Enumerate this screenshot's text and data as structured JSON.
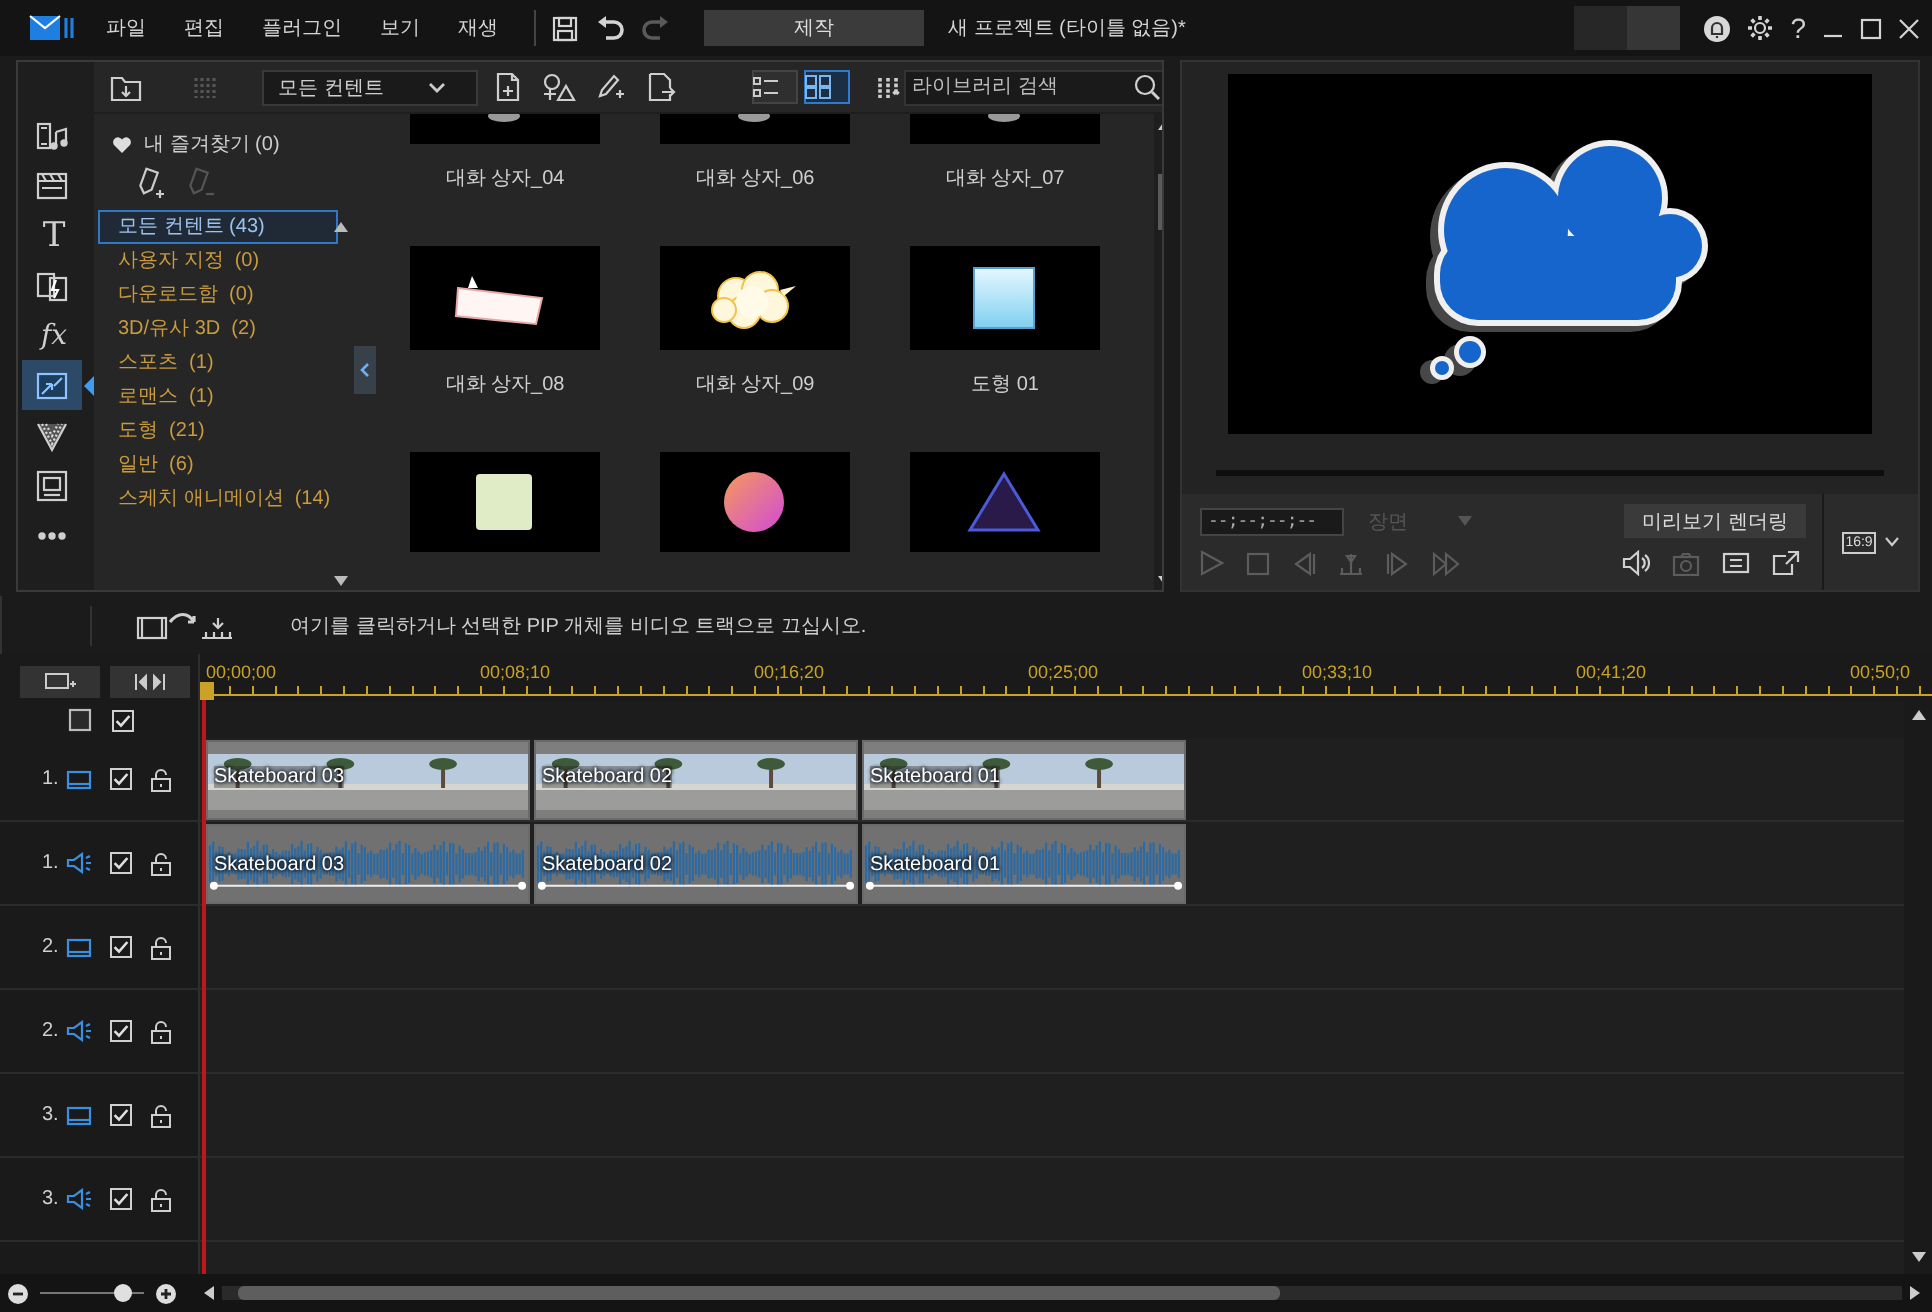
{
  "menu_bar": {
    "menus": [
      "파일",
      "편집",
      "플러그인",
      "보기",
      "재생"
    ],
    "undo_enabled": true,
    "redo_enabled": false,
    "produce": "제작",
    "title": "새 프로젝트 (타이틀 없음)*",
    "help": "?"
  },
  "library": {
    "rail": [
      {
        "kind": "media",
        "selected": false
      },
      {
        "kind": "title",
        "selected": false
      },
      {
        "kind": "text",
        "glyph": "T",
        "selected": false
      },
      {
        "kind": "transition",
        "selected": false
      },
      {
        "kind": "effect",
        "glyph": "fx",
        "selected": false
      },
      {
        "kind": "pip",
        "selected": true
      },
      {
        "kind": "particle",
        "selected": false
      },
      {
        "kind": "subtitle",
        "selected": false
      },
      {
        "kind": "more",
        "selected": false
      }
    ],
    "filter": "모든 컨텐트",
    "view_modes": [
      {
        "kind": "list",
        "selected": false
      },
      {
        "kind": "grid",
        "selected": true
      }
    ],
    "search": {
      "placeholder": "라이브러리 검색"
    },
    "favorites": "내 즐겨찾기 (0)",
    "categories": [
      {
        "label": "모든 컨텐트 (43)",
        "selected": true
      },
      {
        "label": "사용자 지정  (0)",
        "selected": false
      },
      {
        "label": "다운로드함  (0)",
        "selected": false
      },
      {
        "label": "3D/유사 3D  (2)",
        "selected": false
      },
      {
        "label": "스포츠  (1)",
        "selected": false
      },
      {
        "label": "로맨스  (1)",
        "selected": false
      },
      {
        "label": "도형  (21)",
        "selected": false
      },
      {
        "label": "일반  (6)",
        "selected": false
      },
      {
        "label": "스케치 애니메이션  (14)",
        "selected": false
      }
    ],
    "items": [
      {
        "label": "대화 상자_04",
        "kind": "cropped"
      },
      {
        "label": "대화 상자_06",
        "kind": "cropped"
      },
      {
        "label": "대화 상자_07",
        "kind": "cropped"
      },
      {
        "label": "대화 상자_08",
        "kind": "speech-bubble"
      },
      {
        "label": "대화 상자_09",
        "kind": "cloud"
      },
      {
        "label": "도형 01",
        "kind": "blue-square"
      },
      {
        "kind": "green-square"
      },
      {
        "kind": "circle"
      },
      {
        "kind": "triangle"
      }
    ]
  },
  "preview": {
    "timecode": "--;--;--;--",
    "scope": {
      "label": "장면",
      "disabled": true
    },
    "render_button": "미리보기 렌더링",
    "aspect": "16:9"
  },
  "timeline": {
    "hint": "여기를 클릭하거나 선택한 PIP 개체를 비디오 트랙으로 끄십시오.",
    "ruler": [
      "00;00;00",
      "00;08;10",
      "00;16;20",
      "00;25;00",
      "00;33;10",
      "00;41;20",
      "00;50;0"
    ],
    "master_enabled": true,
    "tracks": [
      {
        "number": "1.",
        "kind": "video",
        "enabled": true,
        "locked": false,
        "clips": [
          "Skateboard 03",
          "Skateboard 02",
          "Skateboard 01"
        ]
      },
      {
        "number": "1.",
        "kind": "audio",
        "enabled": true,
        "locked": false,
        "clips": [
          "Skateboard 03",
          "Skateboard 02",
          "Skateboard 01"
        ]
      },
      {
        "number": "2.",
        "kind": "video",
        "enabled": true,
        "locked": false
      },
      {
        "number": "2.",
        "kind": "audio",
        "enabled": true,
        "locked": false
      },
      {
        "number": "3.",
        "kind": "video",
        "enabled": true,
        "locked": false
      },
      {
        "number": "3.",
        "kind": "audio",
        "enabled": true,
        "locked": false
      }
    ]
  },
  "zoom": {
    "level": 0.78
  }
}
